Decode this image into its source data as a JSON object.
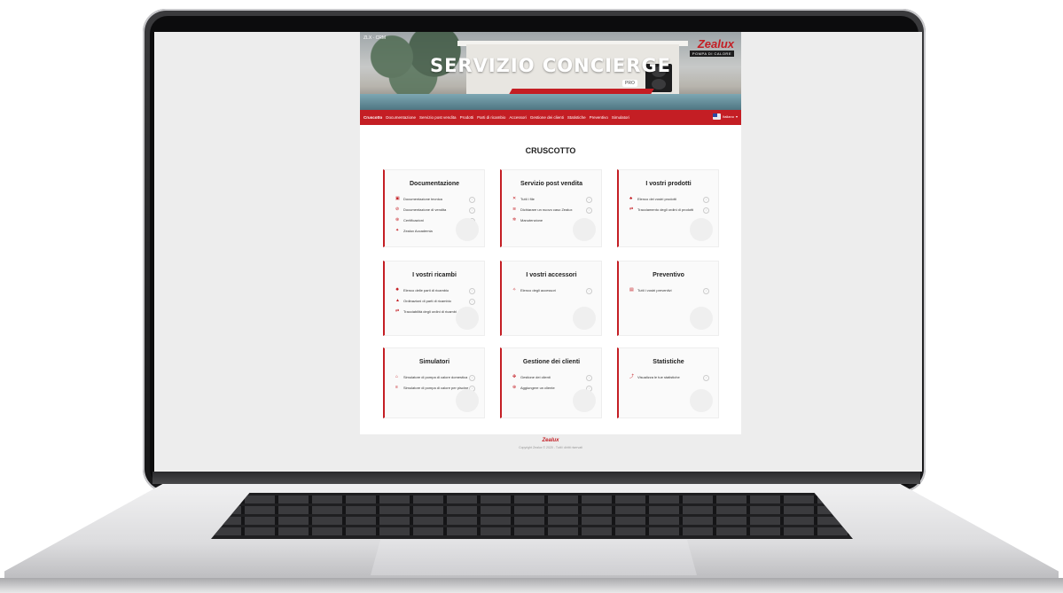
{
  "banner": {
    "title": "SERVIZIO CONCIERGE",
    "badge": "PRO",
    "brand": "Zealux",
    "brand_sub": "POMPA DI CALORE",
    "corner_tag": "ZLX · CRM"
  },
  "nav": {
    "items": [
      {
        "label": "Cruscotto",
        "active": true
      },
      {
        "label": "Documentazione"
      },
      {
        "label": "Servizio post vendita"
      },
      {
        "label": "Prodotti"
      },
      {
        "label": "Parti di ricambio"
      },
      {
        "label": "Accessori"
      },
      {
        "label": "Gestione dei clienti"
      },
      {
        "label": "Statistiche"
      },
      {
        "label": "Preventivo"
      },
      {
        "label": "Simulatori"
      }
    ],
    "language": "Italiano"
  },
  "dashboard": {
    "title": "CRUSCOTTO",
    "cards": [
      {
        "title": "Documentazione",
        "items": [
          {
            "icon": "▣",
            "label": "Documentazione tecnica"
          },
          {
            "icon": "⊘",
            "label": "Documentazione di vendita"
          },
          {
            "icon": "⊛",
            "label": "Certificazioni"
          },
          {
            "icon": "✦",
            "label": "Zealux Accademia"
          }
        ]
      },
      {
        "title": "Servizio post vendita",
        "items": [
          {
            "icon": "✕",
            "label": "Tutti i file"
          },
          {
            "icon": "≋",
            "label": "Dichiarare un nuovo caso Zealux"
          },
          {
            "icon": "✲",
            "label": "Manutenzione"
          }
        ]
      },
      {
        "title": "I vostri prodotti",
        "items": [
          {
            "icon": "♣",
            "label": "Elenco dei vostri prodotti"
          },
          {
            "icon": "⇄",
            "label": "Tracciamento degli ordini di prodotti"
          }
        ]
      },
      {
        "title": "I vostri ricambi",
        "items": [
          {
            "icon": "✹",
            "label": "Elenco delle parti di ricambio"
          },
          {
            "icon": "▲",
            "label": "Ordinazioni di parti di ricambio"
          },
          {
            "icon": "⇄",
            "label": "Tracciabilità degli ordini di ricambi"
          }
        ]
      },
      {
        "title": "I vostri accessori",
        "items": [
          {
            "icon": "✧",
            "label": "Elenco degli accessori"
          }
        ]
      },
      {
        "title": "Preventivo",
        "items": [
          {
            "icon": "▤",
            "label": "Tutti i vostri preventivi"
          }
        ]
      },
      {
        "title": "Simulatori",
        "items": [
          {
            "icon": "⌂",
            "label": "Simulatore di pompa di calore domestica"
          },
          {
            "icon": "≡",
            "label": "Simulatore di pompa di calore per piscine"
          }
        ]
      },
      {
        "title": "Gestione dei clienti",
        "items": [
          {
            "icon": "✤",
            "label": "Gestione dei clienti"
          },
          {
            "icon": "⊕",
            "label": "Aggiungere un cliente"
          }
        ]
      },
      {
        "title": "Statistiche",
        "items": [
          {
            "icon": "⤴",
            "label": "Visualizza le tue statistiche"
          }
        ]
      }
    ]
  },
  "footer": {
    "logo": "Zealux",
    "copyright": "Copyright Zealux © 2020 - Tutti i diritti riservati"
  },
  "colors": {
    "accent": "#c41e24",
    "text": "#222222",
    "card_bg": "#fafafa"
  }
}
